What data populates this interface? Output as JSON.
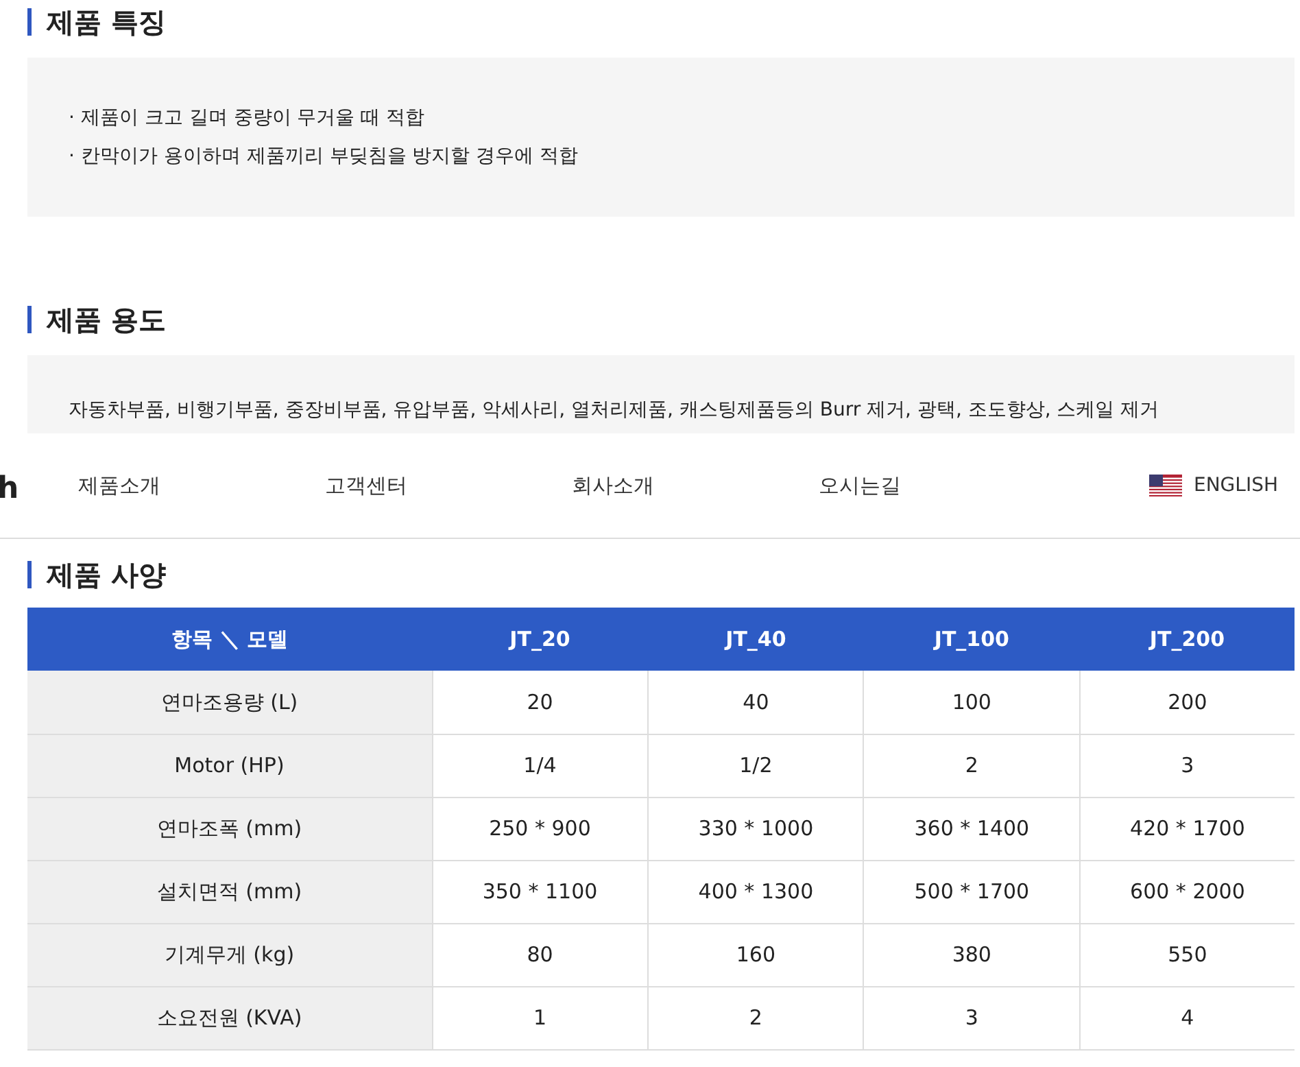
{
  "features": {
    "title": "제품 특징",
    "items": [
      "· 제품이 크고 길며 중량이 무거울 때 적합",
      "· 칸막이가 용이하며 제품끼리 부딪침을 방지할 경우에 적합"
    ]
  },
  "usage": {
    "title": "제품 용도",
    "text": "자동차부품, 비행기부품, 중장비부품, 유압부품, 악세사리, 열처리제품, 캐스팅제품등의 Burr 제거, 광택, 조도향상, 스케일 제거"
  },
  "nav": {
    "logo_fragment": "h",
    "items": [
      "제품소개",
      "고객센터",
      "회사소개",
      "오시는길"
    ],
    "language": "ENGLISH"
  },
  "specs": {
    "title": "제품 사양",
    "columns": [
      "항목 ＼ 모델",
      "JT_20",
      "JT_40",
      "JT_100",
      "JT_200"
    ],
    "rows": [
      [
        "연마조용량 (L)",
        "20",
        "40",
        "100",
        "200"
      ],
      [
        "Motor (HP)",
        "1/4",
        "1/2",
        "2",
        "3"
      ],
      [
        "연마조폭 (mm)",
        "250 * 900",
        "330 * 1000",
        "360 * 1400",
        "420 * 1700"
      ],
      [
        "설치면적 (mm)",
        "350 * 1100",
        "400 * 1300",
        "500 * 1700",
        "600 * 2000"
      ],
      [
        "기계무게 (kg)",
        "80",
        "160",
        "380",
        "550"
      ],
      [
        "소요전원 (KVA)",
        "1",
        "2",
        "3",
        "4"
      ]
    ]
  }
}
